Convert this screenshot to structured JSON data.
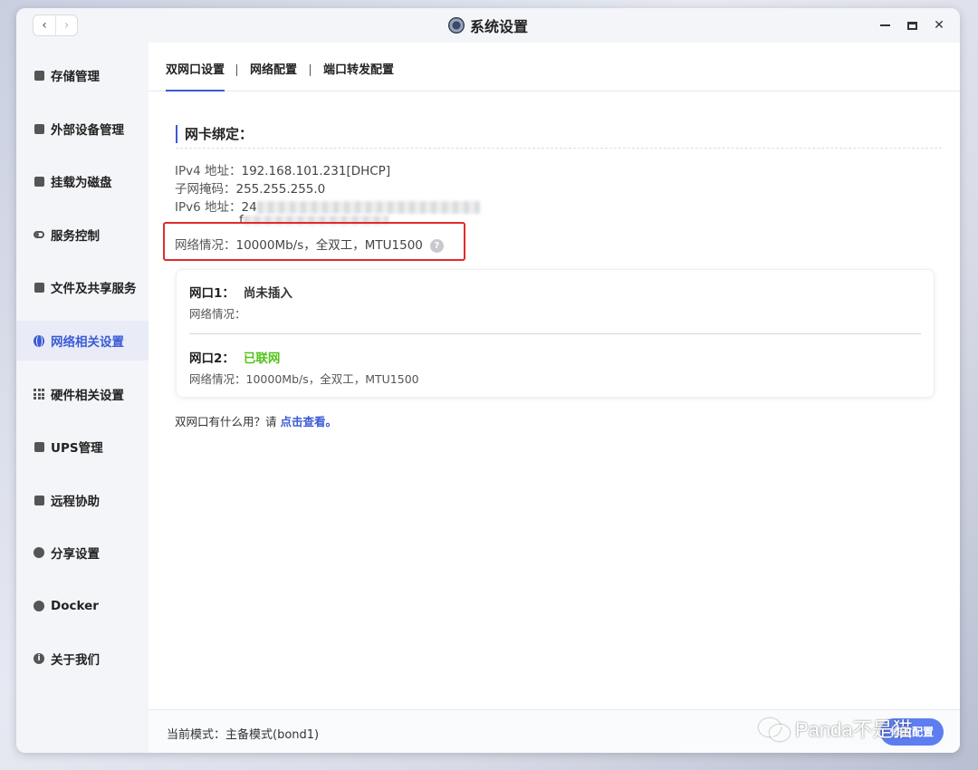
{
  "window": {
    "title": "系统设置"
  },
  "sidebar": {
    "items": [
      {
        "label": "存储管理",
        "icon": "storage-icon"
      },
      {
        "label": "外部设备管理",
        "icon": "external-device-icon"
      },
      {
        "label": "挂载为磁盘",
        "icon": "mount-disk-icon"
      },
      {
        "label": "服务控制",
        "icon": "toggle-icon"
      },
      {
        "label": "文件及共享服务",
        "icon": "file-share-icon"
      },
      {
        "label": "网络相关设置",
        "icon": "globe-icon",
        "active": true
      },
      {
        "label": "硬件相关设置",
        "icon": "grid-icon"
      },
      {
        "label": "UPS管理",
        "icon": "ups-icon"
      },
      {
        "label": "远程协助",
        "icon": "remote-assist-icon"
      },
      {
        "label": "分享设置",
        "icon": "share-icon"
      },
      {
        "label": "Docker",
        "icon": "docker-icon"
      },
      {
        "label": "关于我们",
        "icon": "info-icon"
      }
    ]
  },
  "tabs": [
    {
      "label": "双网口设置",
      "active": true
    },
    {
      "label": "网络配置"
    },
    {
      "label": "端口转发配置"
    }
  ],
  "bond": {
    "title": "网卡绑定：",
    "ipv4_label": "IPv4 地址：",
    "ipv4_value": "192.168.101.231[DHCP]",
    "mask_label": "子网掩码：",
    "mask_value": "255.255.255.0",
    "ipv6_label": "IPv6 地址：",
    "ipv6_visible_start": "24",
    "ipv6_line2_start": "f",
    "net_label": "网络情况：",
    "net_value": "10000Mb/s，全双工，MTU1500"
  },
  "ports": [
    {
      "title": "网口1：",
      "status": "尚未插入",
      "info_label": "网络情况：",
      "info_value": ""
    },
    {
      "title": "网口2：",
      "status": "已联网",
      "info_label": "网络情况：",
      "info_value": "10000Mb/s，全双工，MTU1500"
    }
  ],
  "help": {
    "text": "双网口有什么用？请 ",
    "link": "点击查看。"
  },
  "footer": {
    "mode_text": "当前模式：主备模式(bond1)",
    "button_label": "修改配置"
  },
  "watermark": {
    "text": "Panda不是猫"
  },
  "colors": {
    "accent": "#3b5bd6",
    "success": "#52c41a",
    "highlight": "#e02b2b"
  }
}
